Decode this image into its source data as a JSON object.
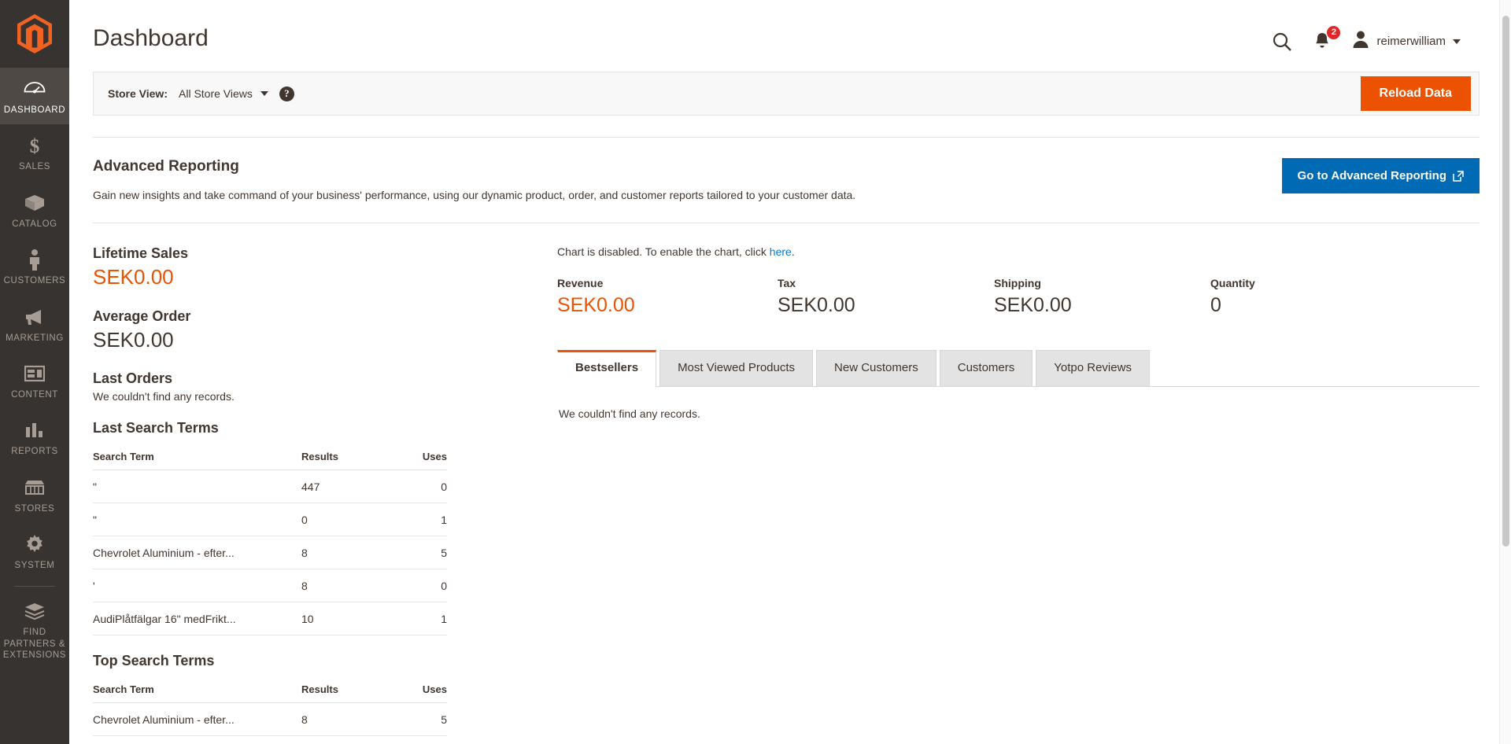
{
  "sidebar": {
    "logo": "magento-logo",
    "items": [
      {
        "label": "Dashboard",
        "icon": "dashboard-icon",
        "active": true
      },
      {
        "label": "Sales",
        "icon": "dollar-icon",
        "active": false
      },
      {
        "label": "Catalog",
        "icon": "box-icon",
        "active": false
      },
      {
        "label": "Customers",
        "icon": "person-icon",
        "active": false
      },
      {
        "label": "Marketing",
        "icon": "megaphone-icon",
        "active": false
      },
      {
        "label": "Content",
        "icon": "layout-icon",
        "active": false
      },
      {
        "label": "Reports",
        "icon": "bar-chart-icon",
        "active": false
      },
      {
        "label": "Stores",
        "icon": "storefront-icon",
        "active": false
      },
      {
        "label": "System",
        "icon": "gear-icon",
        "active": false
      },
      {
        "label": "Find Partners & Extensions",
        "icon": "extensions-icon",
        "active": false
      }
    ]
  },
  "header": {
    "title": "Dashboard",
    "search_icon": "search-icon",
    "notifications_icon": "bell-icon",
    "notifications_count": "2",
    "avatar_icon": "user-icon",
    "user_name": "reimerwilliam",
    "caret_icon": "chevron-down-icon"
  },
  "store_view": {
    "label": "Store View:",
    "selected": "All Store Views",
    "help_icon": "question-mark-icon",
    "help_glyph": "?",
    "reload_label": "Reload Data"
  },
  "advanced_reporting": {
    "title": "Advanced Reporting",
    "description": "Gain new insights and take command of your business' performance, using our dynamic product, order, and customer reports tailored to your customer data.",
    "button_label": "Go to Advanced Reporting",
    "button_icon": "external-link-icon"
  },
  "stats": {
    "lifetime_sales_label": "Lifetime Sales",
    "lifetime_sales_value": "SEK0.00",
    "average_order_label": "Average Order",
    "average_order_value": "SEK0.00",
    "last_orders_label": "Last Orders",
    "last_orders_empty": "We couldn't find any records."
  },
  "last_search_terms": {
    "title": "Last Search Terms",
    "columns": [
      "Search Term",
      "Results",
      "Uses"
    ],
    "rows": [
      {
        "term": "\"",
        "results": "447",
        "uses": "0"
      },
      {
        "term": "\"",
        "results": "0",
        "uses": "1"
      },
      {
        "term": "Chevrolet Aluminium - efter...",
        "results": "8",
        "uses": "5"
      },
      {
        "term": "'",
        "results": "8",
        "uses": "0"
      },
      {
        "term": "AudiPlåtfälgar 16\" medFrikt...",
        "results": "10",
        "uses": "1"
      }
    ]
  },
  "top_search_terms": {
    "title": "Top Search Terms",
    "columns": [
      "Search Term",
      "Results",
      "Uses"
    ],
    "rows": [
      {
        "term": "Chevrolet Aluminium - efter...",
        "results": "8",
        "uses": "5"
      }
    ]
  },
  "chart": {
    "disabled_prefix": "Chart is disabled. To enable the chart, click ",
    "link_label": "here",
    "disabled_suffix": "."
  },
  "totals": [
    {
      "label": "Revenue",
      "value": "SEK0.00",
      "accent": true
    },
    {
      "label": "Tax",
      "value": "SEK0.00",
      "accent": false
    },
    {
      "label": "Shipping",
      "value": "SEK0.00",
      "accent": false
    },
    {
      "label": "Quantity",
      "value": "0",
      "accent": false
    }
  ],
  "tabs": [
    {
      "label": "Bestsellers",
      "active": true
    },
    {
      "label": "Most Viewed Products",
      "active": false
    },
    {
      "label": "New Customers",
      "active": false
    },
    {
      "label": "Customers",
      "active": false
    },
    {
      "label": "Yotpo Reviews",
      "active": false
    }
  ],
  "tab_panel": {
    "empty_message": "We couldn't find any records."
  },
  "colors": {
    "accent_orange": "#eb5202",
    "link_blue": "#007bdb",
    "button_blue": "#006bb4",
    "sidebar_bg": "#373330",
    "badge_red": "#e22626"
  }
}
